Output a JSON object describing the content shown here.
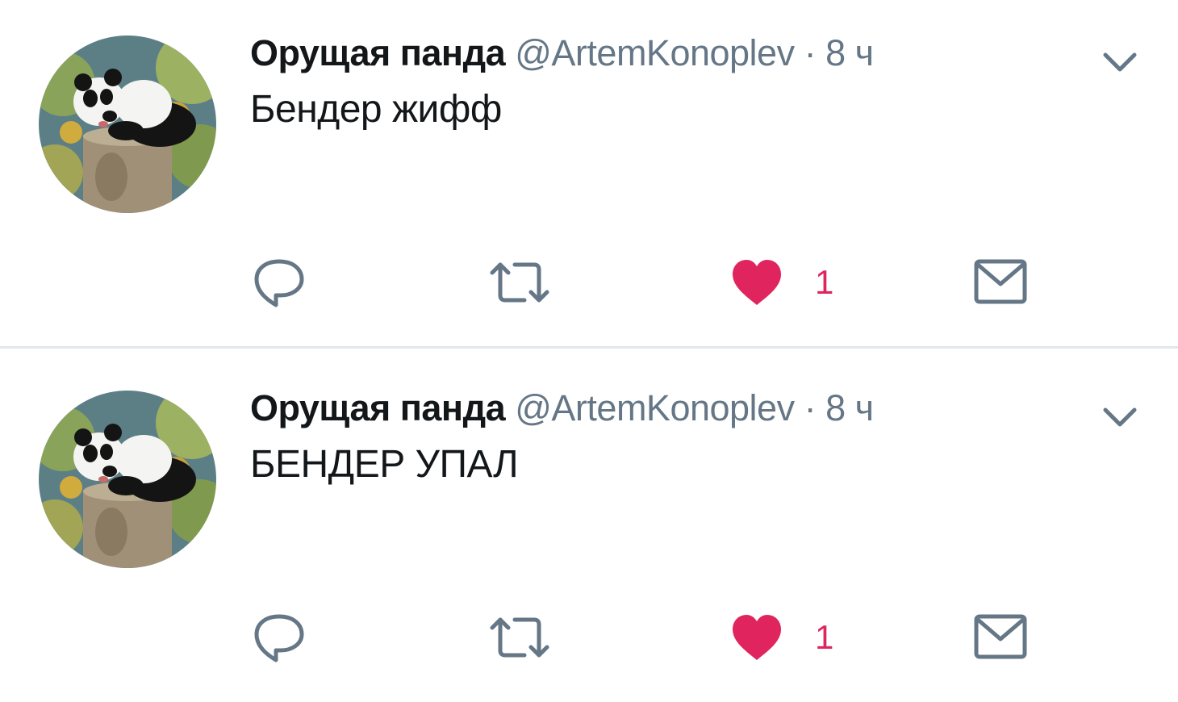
{
  "colors": {
    "name": "#14171a",
    "secondary": "#657786",
    "like": "#e0245e",
    "divider": "#e1e8ed"
  },
  "tweets": [
    {
      "display_name": "Орущая панда",
      "handle": "@ArtemKonoplev",
      "separator": "·",
      "time": "8 ч",
      "text": "Бендер жифф",
      "like_count": "1",
      "icons": [
        "reply-icon",
        "retweet-icon",
        "like-heart-icon",
        "direct-message-icon",
        "chevron-down-icon"
      ]
    },
    {
      "display_name": "Орущая панда",
      "handle": "@ArtemKonoplev",
      "separator": "·",
      "time": "8 ч",
      "text": "БЕНДЕР УПАЛ",
      "like_count": "1",
      "icons": [
        "reply-icon",
        "retweet-icon",
        "like-heart-icon",
        "direct-message-icon",
        "chevron-down-icon"
      ]
    }
  ]
}
